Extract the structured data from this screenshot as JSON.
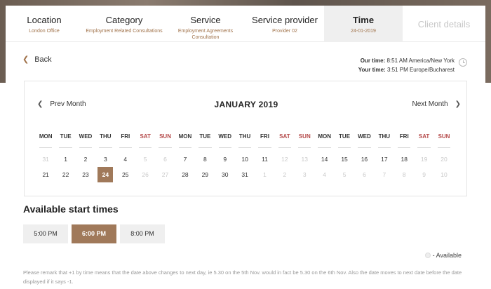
{
  "steps": [
    {
      "title": "Location",
      "sub": "London Office",
      "state": "done"
    },
    {
      "title": "Category",
      "sub": "Employment Related Consultations",
      "state": "done"
    },
    {
      "title": "Service",
      "sub": "Employment Agreements Consultation",
      "state": "done"
    },
    {
      "title": "Service provider",
      "sub": "Provider 02",
      "state": "done"
    },
    {
      "title": "Time",
      "sub": "24-01-2019",
      "state": "active"
    },
    {
      "title": "Client details",
      "sub": "",
      "state": "disabled"
    }
  ],
  "back_label": "Back",
  "time_info": {
    "our_label": "Our time:",
    "our_value": "8:51 AM America/New York",
    "your_label": "Your time:",
    "your_value": "3:51 PM Europe/Bucharest"
  },
  "calendar": {
    "prev_label": "Prev Month",
    "next_label": "Next Month",
    "month_title": "JANUARY 2019",
    "weekdays": [
      "MON",
      "TUE",
      "WED",
      "THU",
      "FRI",
      "SAT",
      "SUN",
      "MON",
      "TUE",
      "WED",
      "THU",
      "FRI",
      "SAT",
      "SUN",
      "MON",
      "TUE",
      "WED",
      "THU",
      "FRI",
      "SAT",
      "SUN"
    ],
    "row1": [
      "31",
      "1",
      "2",
      "3",
      "4",
      "5",
      "6",
      "7",
      "8",
      "9",
      "10",
      "11",
      "12",
      "13",
      "14",
      "15",
      "16",
      "17",
      "18",
      "19",
      "20"
    ],
    "row2": [
      "21",
      "22",
      "23",
      "24",
      "25",
      "26",
      "27",
      "28",
      "29",
      "30",
      "31",
      "1",
      "2",
      "3",
      "4",
      "5",
      "6",
      "7",
      "8",
      "9",
      "10"
    ],
    "selected": "24"
  },
  "available_title": "Available start times",
  "time_slots": [
    {
      "label": "5:00 PM",
      "active": false
    },
    {
      "label": "6:00 PM",
      "active": true
    },
    {
      "label": "8:00 PM",
      "active": false
    }
  ],
  "legend_label": "- Available",
  "note": "Please remark that +1 by time means that the date above changes to next day, ie 5.30 on the 5th Nov. would in fact be 5.30 on the 6th Nov. Also the date moves to next date before the date displayed if it says -1.",
  "colors": {
    "accent": "#a0795a",
    "weekend": "#b54a4a",
    "subtitle": "#a0724a"
  }
}
